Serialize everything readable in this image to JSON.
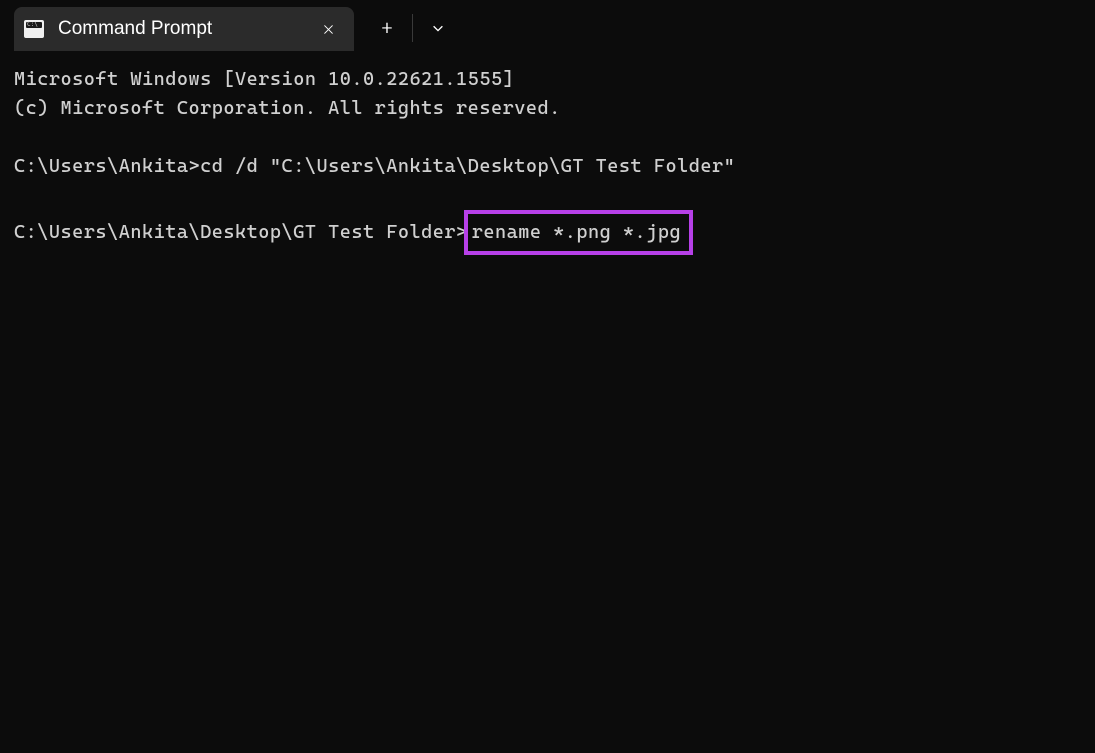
{
  "tab": {
    "title": "Command Prompt"
  },
  "terminal": {
    "line1": "Microsoft Windows [Version 10.0.22621.1555]",
    "line2": "(c) Microsoft Corporation. All rights reserved.",
    "prompt1": "C:\\Users\\Ankita>",
    "command1": "cd /d \"C:\\Users\\Ankita\\Desktop\\GT Test Folder\"",
    "prompt2": "C:\\Users\\Ankita\\Desktop\\GT Test Folder>",
    "command2": "rename *.png *.jpg"
  }
}
